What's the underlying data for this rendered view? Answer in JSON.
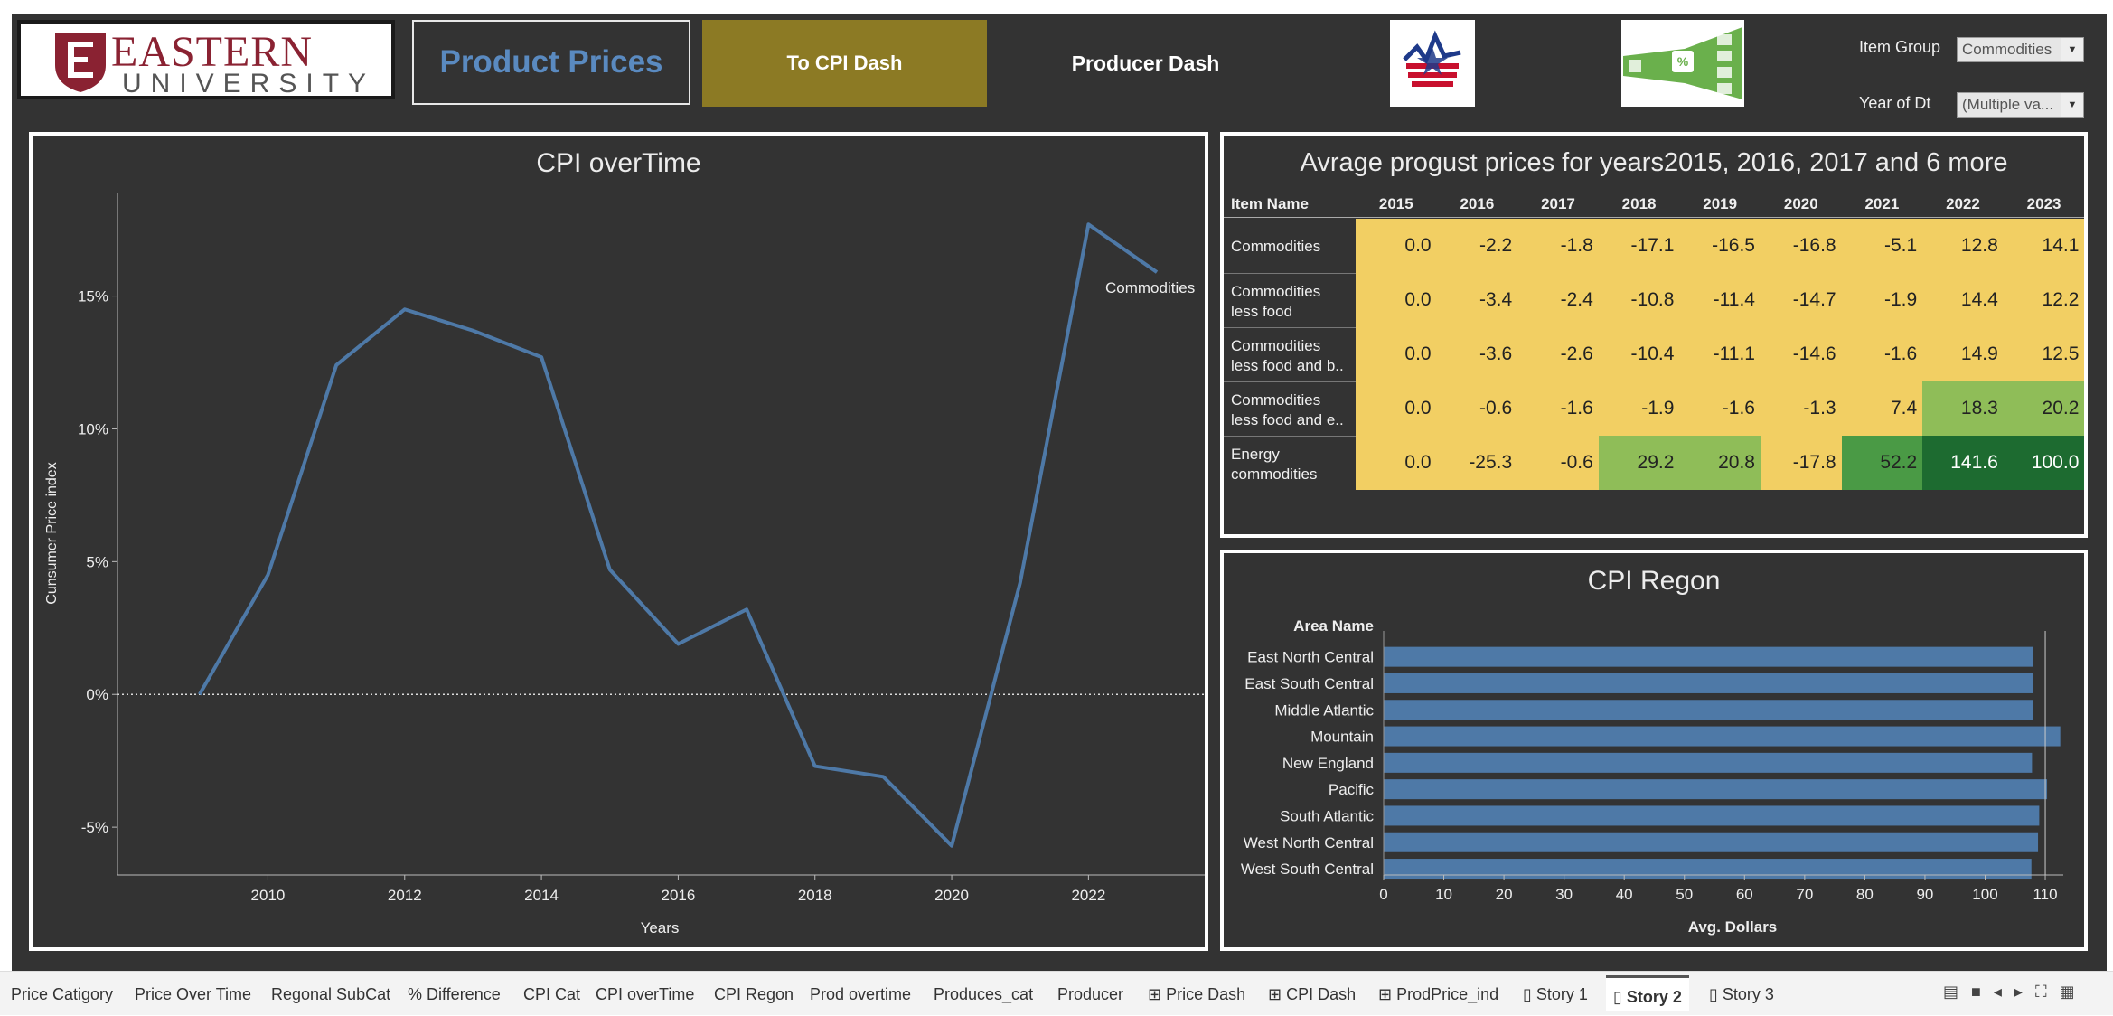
{
  "header": {
    "logo_word1": "EASTERN",
    "logo_word2": "UNIVERSITY",
    "title": "Product Prices",
    "btn_cpi": "To CPI Dash",
    "btn_producer": "Producer Dash"
  },
  "filters": {
    "item_group_label": "Item Group",
    "item_group_value": "Commodities",
    "year_label": "Year of Dt",
    "year_value": "(Multiple va..."
  },
  "line_chart": {
    "title": "CPI overTime",
    "ylabel": "Cunsumer Price index",
    "xlabel": "Years",
    "series_label": "Commodities"
  },
  "table": {
    "title": "Avrage progust prices for years2015, 2016, 2017 and 6 more",
    "row_header": "Item Name",
    "years": [
      "2015",
      "2016",
      "2017",
      "2018",
      "2019",
      "2020",
      "2021",
      "2022",
      "2023"
    ],
    "rows": [
      {
        "name1": "Commodities",
        "name2": "",
        "values": [
          "0.0",
          "-2.2",
          "-1.8",
          "-17.1",
          "-16.5",
          "-16.8",
          "-5.1",
          "12.8",
          "14.1"
        ]
      },
      {
        "name1": "Commodities",
        "name2": "less food",
        "values": [
          "0.0",
          "-3.4",
          "-2.4",
          "-10.8",
          "-11.4",
          "-14.7",
          "-1.9",
          "14.4",
          "12.2"
        ]
      },
      {
        "name1": "Commodities",
        "name2": "less food and b..",
        "values": [
          "0.0",
          "-3.6",
          "-2.6",
          "-10.4",
          "-11.1",
          "-14.6",
          "-1.6",
          "14.9",
          "12.5"
        ]
      },
      {
        "name1": "Commodities",
        "name2": "less food and e..",
        "values": [
          "0.0",
          "-0.6",
          "-1.6",
          "-1.9",
          "-1.6",
          "-1.3",
          "7.4",
          "18.3",
          "20.2"
        ]
      },
      {
        "name1": "Energy",
        "name2": "commodities",
        "values": [
          "0.0",
          "-25.3",
          "-0.6",
          "29.2",
          "20.8",
          "-17.8",
          "52.2",
          "141.6",
          "100.0"
        ]
      }
    ],
    "colors": {
      "low": "#f2cf63",
      "mid": "#8fbd58",
      "high": "#4a9a45",
      "max": "#1d6b30"
    }
  },
  "bar_chart": {
    "title": "CPI Regon",
    "row_header": "Area Name",
    "xlabel": "Avg. Dollars"
  },
  "tabs": [
    {
      "label": "Price Catigory",
      "icon": ""
    },
    {
      "label": "Price Over Time",
      "icon": ""
    },
    {
      "label": "Regonal SubCat",
      "icon": ""
    },
    {
      "label": "% Difference",
      "icon": ""
    },
    {
      "label": "CPI Cat",
      "icon": ""
    },
    {
      "label": "CPI overTime",
      "icon": ""
    },
    {
      "label": "CPI Regon",
      "icon": ""
    },
    {
      "label": "Prod overtime",
      "icon": ""
    },
    {
      "label": "Produces_cat",
      "icon": ""
    },
    {
      "label": "Producer",
      "icon": ""
    },
    {
      "label": "Price Dash",
      "icon": "dashboard-icon"
    },
    {
      "label": "CPI Dash",
      "icon": "dashboard-icon"
    },
    {
      "label": "ProdPrice_ind",
      "icon": "dashboard-icon"
    },
    {
      "label": "Story 1",
      "icon": "story-icon"
    },
    {
      "label": "Story 2",
      "icon": "story-icon",
      "selected": true
    },
    {
      "label": "Story 3",
      "icon": "story-icon"
    }
  ],
  "chart_data": [
    {
      "type": "line",
      "title": "CPI overTime",
      "xlabel": "Years",
      "ylabel": "Cunsumer Price index",
      "x": [
        2009,
        2010,
        2011,
        2012,
        2013,
        2014,
        2015,
        2016,
        2017,
        2018,
        2019,
        2020,
        2021,
        2022,
        2023
      ],
      "series": [
        {
          "name": "Commodities",
          "values": [
            0.0,
            4.5,
            12.4,
            14.5,
            13.7,
            12.7,
            4.7,
            1.9,
            3.2,
            -2.7,
            -3.1,
            -5.7,
            4.2,
            17.7,
            15.9
          ]
        }
      ],
      "xticks": [
        2010,
        2012,
        2014,
        2016,
        2018,
        2020,
        2022
      ],
      "yticks": [
        -5,
        0,
        5,
        10,
        15
      ],
      "ytick_labels": [
        "-5%",
        "0%",
        "5%",
        "10%",
        "15%"
      ],
      "xlim": [
        2007.8,
        2023.7
      ],
      "ylim": [
        -6.8,
        18.9
      ],
      "color": "#4e79a7"
    },
    {
      "type": "bar",
      "orientation": "horizontal",
      "title": "CPI Regon",
      "xlabel": "Avg. Dollars",
      "categories": [
        "East North Central",
        "East South Central",
        "Middle Atlantic",
        "Mountain",
        "New England",
        "Pacific",
        "South Atlantic",
        "West North Central",
        "West South Central"
      ],
      "values": [
        108.0,
        108.0,
        108.0,
        112.5,
        107.8,
        110.3,
        109.0,
        108.8,
        107.7
      ],
      "xticks": [
        0,
        10,
        20,
        30,
        40,
        50,
        60,
        70,
        80,
        90,
        100,
        110
      ],
      "xlim": [
        0,
        113
      ],
      "color": "#4e79a7"
    }
  ]
}
